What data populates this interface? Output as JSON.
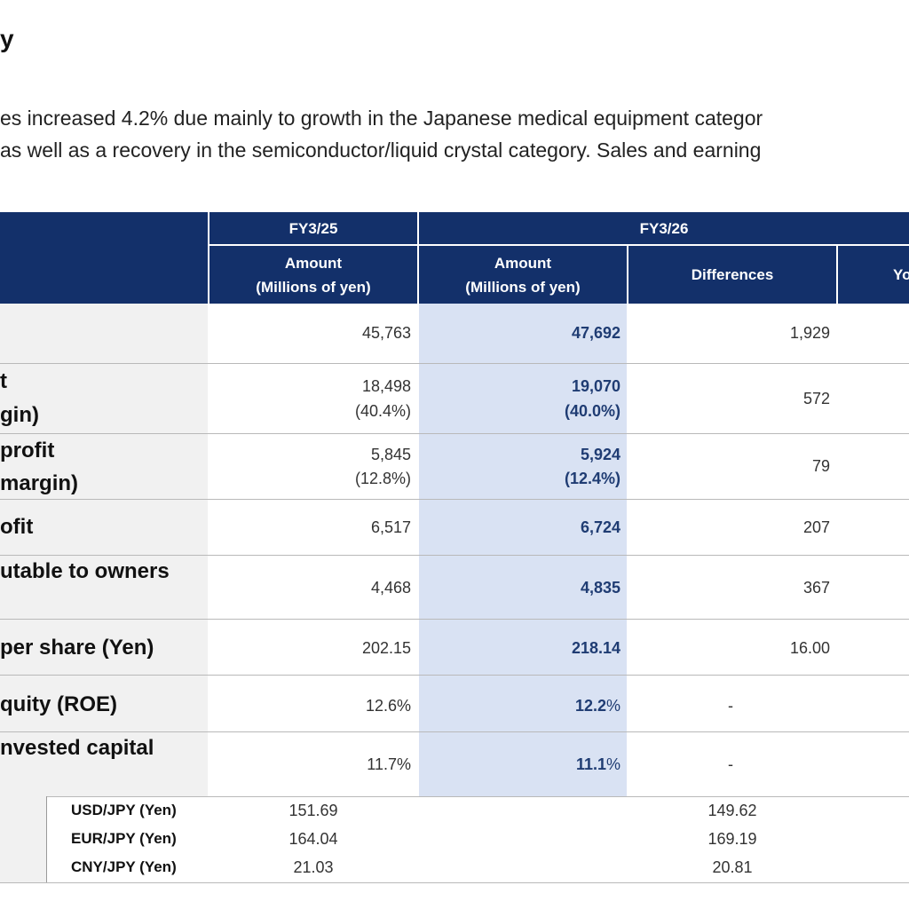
{
  "page": {
    "title": "y",
    "summary_line1": "es increased 4.2% due mainly to growth in the Japanese medical equipment categor",
    "summary_line2": "as well as a recovery in the semiconductor/liquid crystal category. Sales and earning"
  },
  "table": {
    "colors": {
      "header_bg": "#13306a",
      "highlight": "#d9e2f3",
      "label_bg": "#f1f1f1",
      "accent_text": "#1f3c73"
    },
    "period_fy25": "FY3/25",
    "period_fy26": "FY3/26",
    "amount_label_fy25": {
      "line1": "Amount",
      "line2": "(Millions of yen)"
    },
    "amount_label_fy26": {
      "line1": "Amount",
      "line2": "(Millions of yen)"
    },
    "differences_label": "Differences",
    "yoy_label_partial": "Yo",
    "rows": [
      {
        "label_lines": [
          ""
        ],
        "fy25": "45,763",
        "fy25_sub": "",
        "fy26": "47,692",
        "fy26_sub": "",
        "diff": "1,929"
      },
      {
        "label_lines": [
          "t",
          "gin)"
        ],
        "fy25": "18,498",
        "fy25_sub": "(40.4%)",
        "fy26": "19,070",
        "fy26_sub": "(40.0%)",
        "diff": "572"
      },
      {
        "label_lines": [
          "profit",
          "margin)"
        ],
        "fy25": "5,845",
        "fy25_sub": "(12.8%)",
        "fy26": "5,924",
        "fy26_sub": "(12.4%)",
        "diff": "79"
      },
      {
        "label_lines": [
          "ofit"
        ],
        "fy25": "6,517",
        "fy25_sub": "",
        "fy26": "6,724",
        "fy26_sub": "",
        "diff": "207"
      },
      {
        "label_lines": [
          "utable to owners"
        ],
        "fy25": "4,468",
        "fy25_sub": "",
        "fy26": "4,835",
        "fy26_sub": "",
        "diff": "367"
      },
      {
        "label_lines": [
          "per share (Yen)"
        ],
        "fy25": "202.15",
        "fy25_sub": "",
        "fy26": "218.14",
        "fy26_sub": "",
        "diff": "16.00"
      },
      {
        "label_lines": [
          "quity (ROE)"
        ],
        "fy25": "12.6%",
        "fy25_sub": "",
        "fy26_num": "12.2",
        "fy26_pct": "%",
        "diff": "-"
      },
      {
        "label_lines": [
          "nvested capital"
        ],
        "fy25": "11.7%",
        "fy25_sub": "",
        "fy26_num": "11.1",
        "fy26_pct": "%",
        "diff": "-"
      }
    ],
    "fx": [
      {
        "label": "USD/JPY (Yen)",
        "fy25": "151.69",
        "fy26": "149.62"
      },
      {
        "label": "EUR/JPY (Yen)",
        "fy25": "164.04",
        "fy26": "169.19"
      },
      {
        "label": "CNY/JPY (Yen)",
        "fy25": "21.03",
        "fy26": "20.81"
      }
    ]
  }
}
